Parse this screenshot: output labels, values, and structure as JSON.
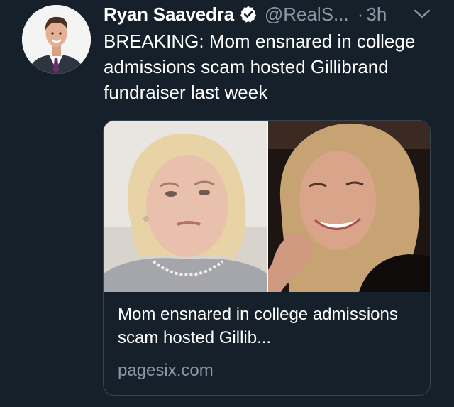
{
  "tweet": {
    "author": {
      "display_name": "Ryan Saavedra",
      "handle": "@RealS...",
      "avatar_icon": "profile-photo",
      "verified_icon": "verified-badge-icon"
    },
    "separator": "·",
    "timestamp": "3h",
    "menu_icon": "chevron-down-icon",
    "text": "BREAKING: Mom ensnared in college admissions scam hosted Gillibrand fundraiser last week",
    "card": {
      "image_icon": "news-photo",
      "title": "Mom ensnared in college admissions scam hosted Gillib...",
      "domain": "pagesix.com"
    }
  },
  "colors": {
    "background": "#15202b",
    "primary_text": "#ffffff",
    "secondary_text": "#8899a6",
    "card_border": "#38444d"
  }
}
